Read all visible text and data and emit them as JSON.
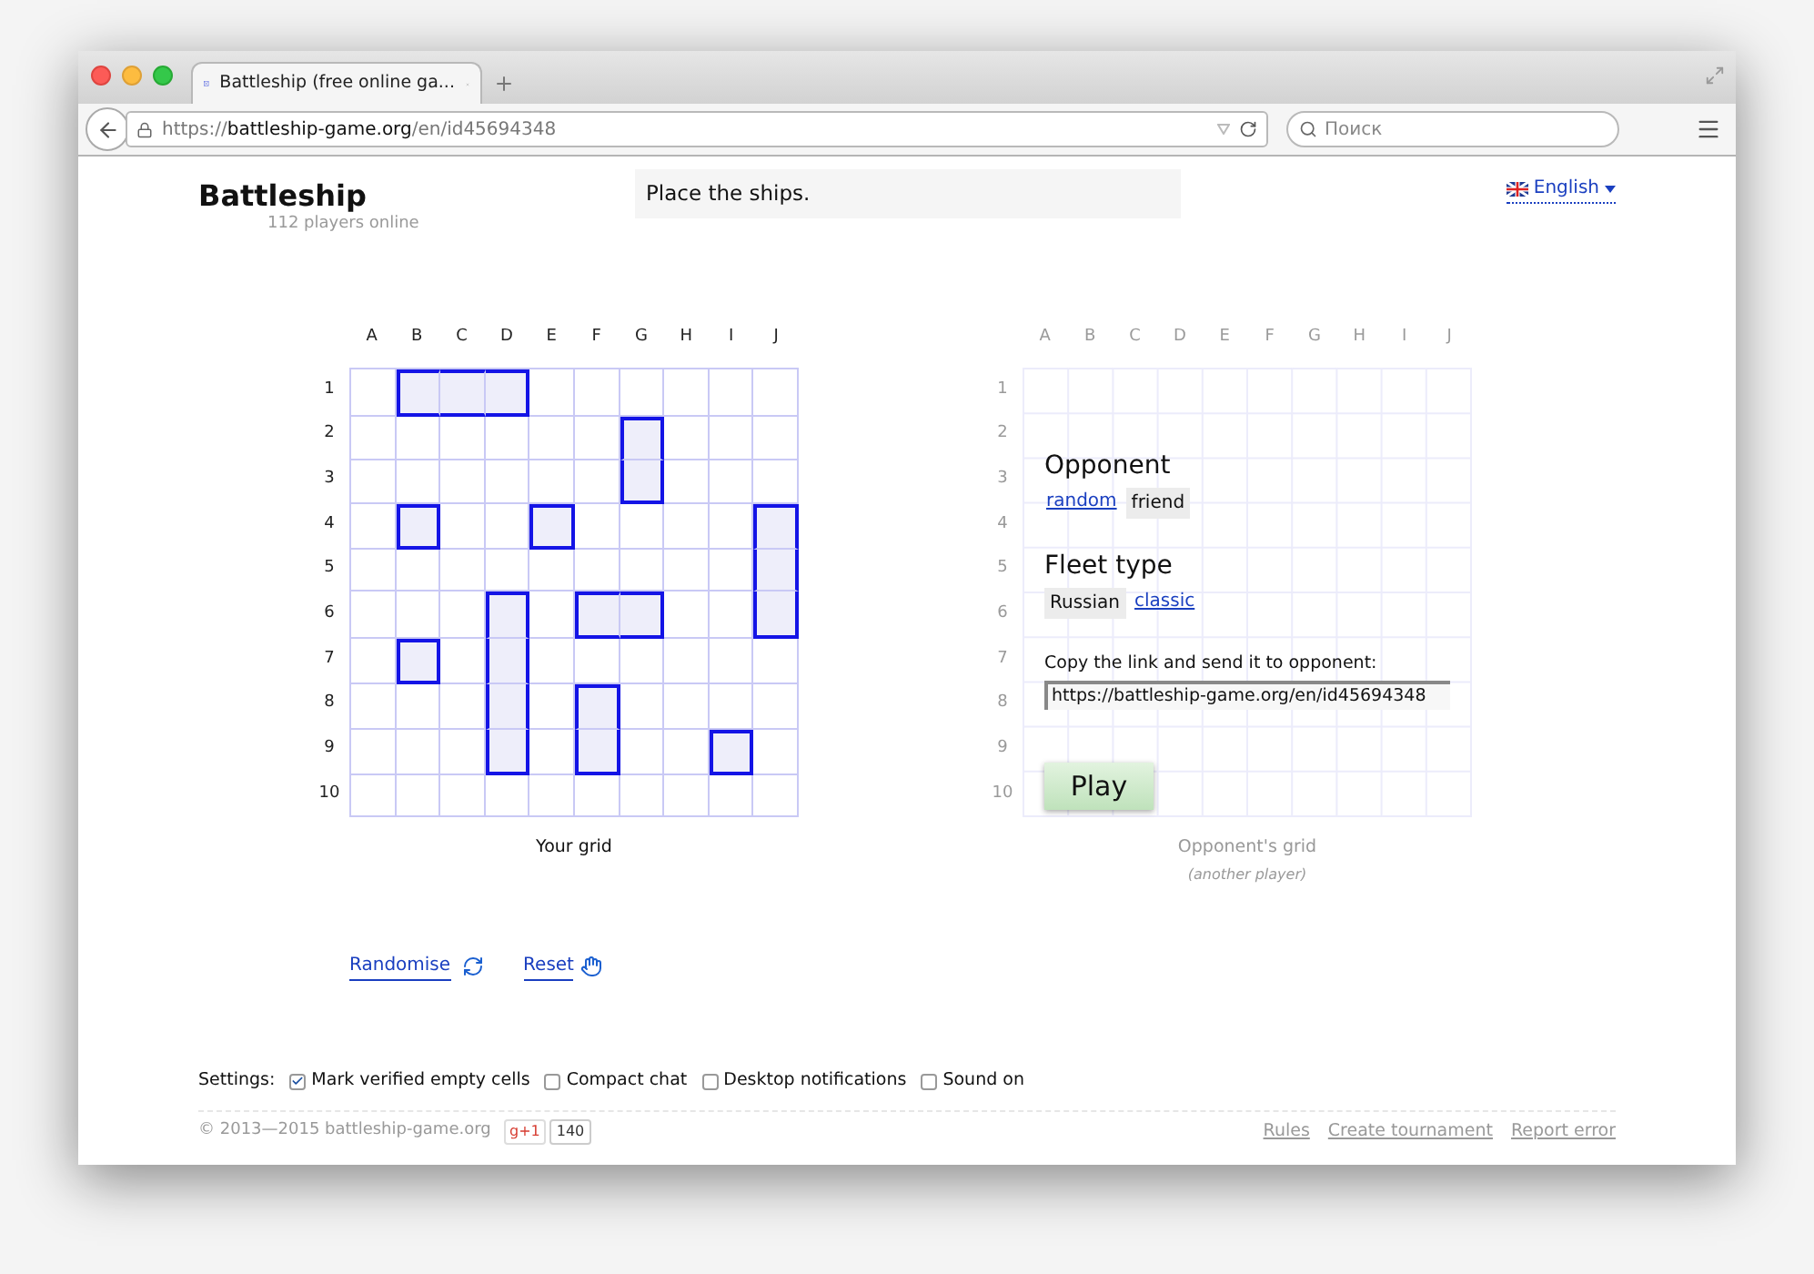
{
  "browser": {
    "tab_title": "Battleship (free online ga...",
    "url_scheme": "https://",
    "url_host": "battleship-game.org",
    "url_path": "/en/id45694348",
    "search_placeholder": "Поиск"
  },
  "header": {
    "title": "Battleship",
    "subtitle": "112 players online",
    "status": "Place the ships.",
    "language": "English"
  },
  "your_grid": {
    "columns": [
      "A",
      "B",
      "C",
      "D",
      "E",
      "F",
      "G",
      "H",
      "I",
      "J"
    ],
    "rows": [
      "1",
      "2",
      "3",
      "4",
      "5",
      "6",
      "7",
      "8",
      "9",
      "10"
    ],
    "caption": "Your grid",
    "ship_cells": [
      [
        false,
        true,
        true,
        true,
        false,
        false,
        false,
        false,
        false,
        false
      ],
      [
        false,
        false,
        false,
        false,
        false,
        false,
        true,
        false,
        false,
        false
      ],
      [
        false,
        false,
        false,
        false,
        false,
        false,
        true,
        false,
        false,
        false
      ],
      [
        false,
        true,
        false,
        false,
        true,
        false,
        false,
        false,
        false,
        true
      ],
      [
        false,
        false,
        false,
        false,
        false,
        false,
        false,
        false,
        false,
        true
      ],
      [
        false,
        false,
        false,
        true,
        false,
        true,
        true,
        false,
        false,
        true
      ],
      [
        false,
        true,
        false,
        true,
        false,
        false,
        false,
        false,
        false,
        false
      ],
      [
        false,
        false,
        false,
        true,
        false,
        true,
        false,
        false,
        false,
        false
      ],
      [
        false,
        false,
        false,
        true,
        false,
        true,
        false,
        false,
        true,
        false
      ],
      [
        false,
        false,
        false,
        false,
        false,
        false,
        false,
        false,
        false,
        false
      ]
    ]
  },
  "opponent_grid": {
    "columns": [
      "A",
      "B",
      "C",
      "D",
      "E",
      "F",
      "G",
      "H",
      "I",
      "J"
    ],
    "rows": [
      "1",
      "2",
      "3",
      "4",
      "5",
      "6",
      "7",
      "8",
      "9",
      "10"
    ],
    "caption": "Opponent's grid",
    "subcaption": "(another player)"
  },
  "opponent": {
    "heading": "Opponent",
    "options": [
      {
        "label": "random",
        "selected": false
      },
      {
        "label": "friend",
        "selected": true
      }
    ]
  },
  "fleet_type": {
    "heading": "Fleet type",
    "options": [
      {
        "label": "Russian",
        "selected": true
      },
      {
        "label": "classic",
        "selected": false
      }
    ]
  },
  "share": {
    "label": "Copy the link and send it to opponent:",
    "value": "https://battleship-game.org/en/id45694348"
  },
  "play_button": "Play",
  "actions": {
    "randomise": "Randomise",
    "reset": "Reset"
  },
  "settings": {
    "label": "Settings:",
    "items": [
      {
        "label": "Mark verified empty cells",
        "checked": true
      },
      {
        "label": "Compact chat",
        "checked": false
      },
      {
        "label": "Desktop notifications",
        "checked": false
      },
      {
        "label": "Sound on",
        "checked": false
      }
    ]
  },
  "footer": {
    "copyright": "© 2013—2015 battleship-game.org",
    "plus_one": "g+1",
    "plus_count": "140",
    "links": [
      "Rules",
      "Create tournament",
      "Report error"
    ]
  }
}
